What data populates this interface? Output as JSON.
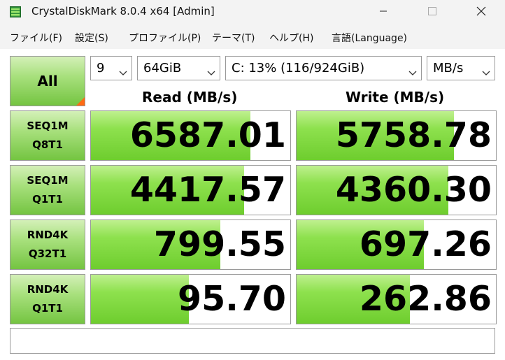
{
  "window": {
    "title": "CrystalDiskMark 8.0.4 x64 [Admin]",
    "accent_color": "#1e7a2e"
  },
  "menu": {
    "items": [
      {
        "label": "ファイル(F)"
      },
      {
        "label": "設定(S)"
      },
      {
        "label": "プロファイル(P)"
      },
      {
        "label": "テーマ(T)"
      },
      {
        "label": "ヘルプ(H)"
      },
      {
        "label": "言語(Language)"
      }
    ]
  },
  "controls": {
    "all_label": "All",
    "count_value": "9",
    "size_value": "64GiB",
    "drive_value": "C: 13% (116/924GiB)",
    "unit_value": "MB/s"
  },
  "headers": {
    "read": "Read (MB/s)",
    "write": "Write (MB/s)"
  },
  "tests": [
    {
      "line1": "SEQ1M",
      "line2": "Q8T1",
      "read": "6587.01",
      "write": "5758.78",
      "read_fill": 0.8,
      "write_fill": 0.79
    },
    {
      "line1": "SEQ1M",
      "line2": "Q1T1",
      "read": "4417.57",
      "write": "4360.30",
      "read_fill": 0.77,
      "write_fill": 0.76
    },
    {
      "line1": "RND4K",
      "line2": "Q32T1",
      "read": "799.55",
      "write": "697.26",
      "read_fill": 0.65,
      "write_fill": 0.64
    },
    {
      "line1": "RND4K",
      "line2": "Q1T1",
      "read": "95.70",
      "write": "262.86",
      "read_fill": 0.49,
      "write_fill": 0.57
    }
  ],
  "comment": "",
  "colors": {
    "bar_green": "#7ad63e",
    "button_green": "#a8e07d",
    "all_corner": "#ff6a13"
  },
  "icons": {
    "app": "crystaldiskmark-icon",
    "minimize": "minimize-icon",
    "maximize": "maximize-icon",
    "close": "close-icon",
    "dropdown": "chevron-down-icon"
  }
}
